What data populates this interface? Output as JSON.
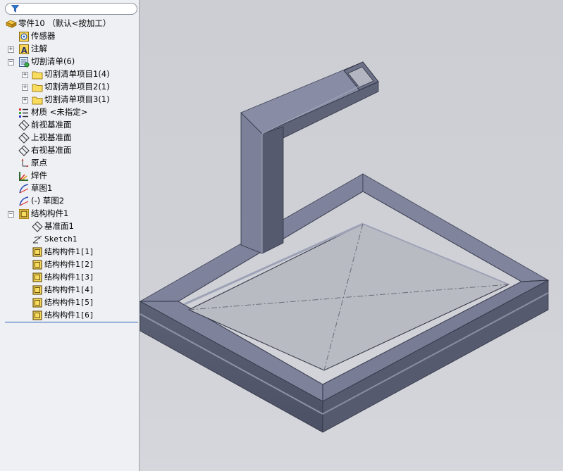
{
  "tree": {
    "root": "零件10 （默认<按加工）",
    "sensors": "传感器",
    "annotations": "注解",
    "cutlist": "切割清单(6)",
    "cutlist_items": [
      "切割清单项目1(4)",
      "切割清单项目2(1)",
      "切割清单项目3(1)"
    ],
    "material": "材质 <未指定>",
    "front_plane": "前视基准面",
    "top_plane": "上视基准面",
    "right_plane": "右视基准面",
    "origin": "原点",
    "weldment": "焊件",
    "sketch1": "草图1",
    "sketch2": "(-) 草图2",
    "structure": "结构构件1",
    "structure_children": {
      "plane1": "基准面1",
      "sketch1": "Sketch1",
      "members": [
        "结构构件1[1]",
        "结构构件1[2]",
        "结构构件1[3]",
        "结构构件1[4]",
        "结构构件1[5]",
        "结构构件1[6]"
      ]
    }
  },
  "icons": {
    "filter": "filter-icon",
    "folder": "folder-icon",
    "plane": "plane-icon"
  },
  "colors": {
    "panel_bg": "#eef0f3",
    "viewport_bg": "#cfd1d7",
    "steel": "#6c7286",
    "selection_line": "#2b60b8"
  }
}
